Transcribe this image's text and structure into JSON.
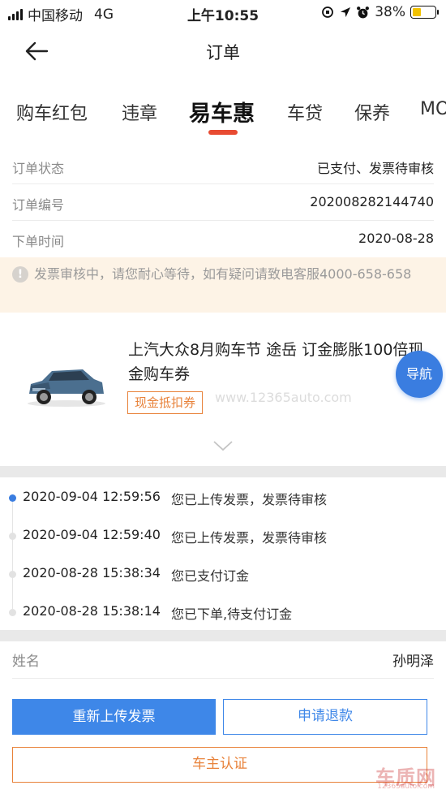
{
  "status_bar": {
    "carrier": "中国移动",
    "network": "4G",
    "time": "上午10:55",
    "battery": "38%"
  },
  "nav": {
    "title": "订单"
  },
  "tabs": [
    {
      "label": "购车红包",
      "active": false
    },
    {
      "label": "违章",
      "active": false
    },
    {
      "label": "易车惠",
      "active": true
    },
    {
      "label": "车贷",
      "active": false
    },
    {
      "label": "保养",
      "active": false
    },
    {
      "label": "MO",
      "active": false
    }
  ],
  "order_info": [
    {
      "label": "订单状态",
      "value": "已支付、发票待审核"
    },
    {
      "label": "订单编号",
      "value": "202008282144740"
    },
    {
      "label": "下单时间",
      "value": "2020-08-28"
    }
  ],
  "notice": {
    "text": "发票审核中，请您耐心等待，如有疑问请致电客服4000-658-658"
  },
  "product": {
    "title": "上汽大众8月购车节 途岳 订金膨胀100倍现金购车券",
    "tag": "现金抵扣券",
    "watermark": "www.12365auto.com",
    "navigate_label": "导航"
  },
  "timeline": [
    {
      "time": "2020-09-04 12:59:56",
      "desc": "您已上传发票，发票待审核",
      "active": true
    },
    {
      "time": "2020-09-04 12:59:40",
      "desc": "您已上传发票，发票待审核",
      "active": false
    },
    {
      "time": "2020-08-28 15:38:34",
      "desc": "您已支付订金",
      "active": false
    },
    {
      "time": "2020-08-28 15:38:14",
      "desc": "您已下单,待支付订金",
      "active": false
    }
  ],
  "buyer": {
    "label": "姓名",
    "value": "孙明泽"
  },
  "actions": {
    "reupload": "重新上传发票",
    "refund": "申请退款",
    "owner_verify": "车主认证"
  },
  "logo": {
    "big": "车质网",
    "small": "12365auto.com"
  },
  "colors": {
    "accent_blue": "#3e87e8",
    "accent_orange": "#e8823a",
    "tab_underline": "#e84b32"
  },
  "icons": {
    "back": "arrow-left-icon",
    "notice": "exclamation-circle-icon",
    "expand": "chevron-down-icon"
  }
}
